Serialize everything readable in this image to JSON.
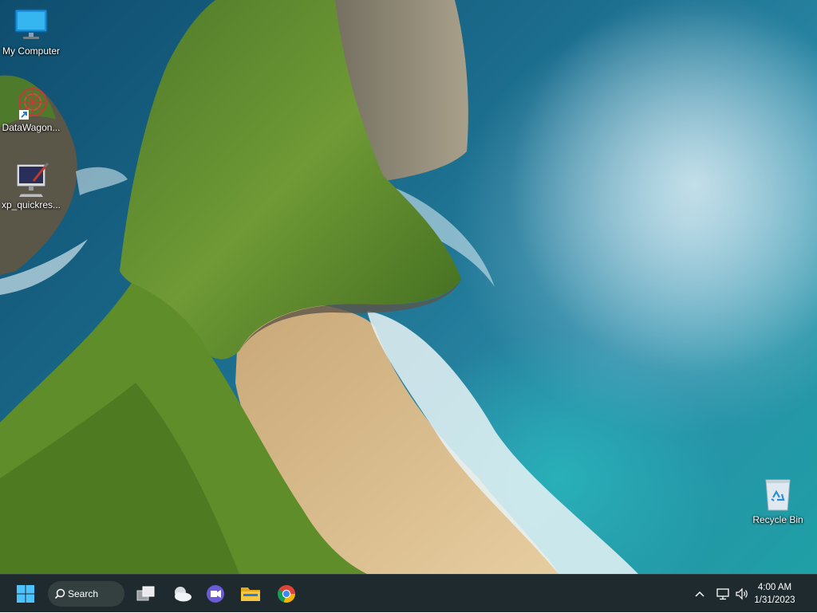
{
  "desktop": {
    "icons": [
      {
        "name": "my-computer-icon",
        "label": "My Computer"
      },
      {
        "name": "datawagon-icon",
        "label": "DataWagon..."
      },
      {
        "name": "xp-quickres-icon",
        "label": "xp_quickres..."
      },
      {
        "name": "recycle-bin-icon",
        "label": "Recycle Bin"
      }
    ]
  },
  "taskbar": {
    "search_label": "Search",
    "apps": [
      "start-icon",
      "search-icon",
      "task-view-icon",
      "weather-widget-icon",
      "teams-chat-icon",
      "file-explorer-icon",
      "chrome-icon"
    ],
    "tray": [
      "chevron-up-icon",
      "network-icon",
      "volume-icon"
    ],
    "clock": {
      "time": "4:00 AM",
      "date": "1/31/2023"
    }
  },
  "colors": {
    "taskbar_bg": "#1f2a2f",
    "accent": "#4cc2ff"
  }
}
